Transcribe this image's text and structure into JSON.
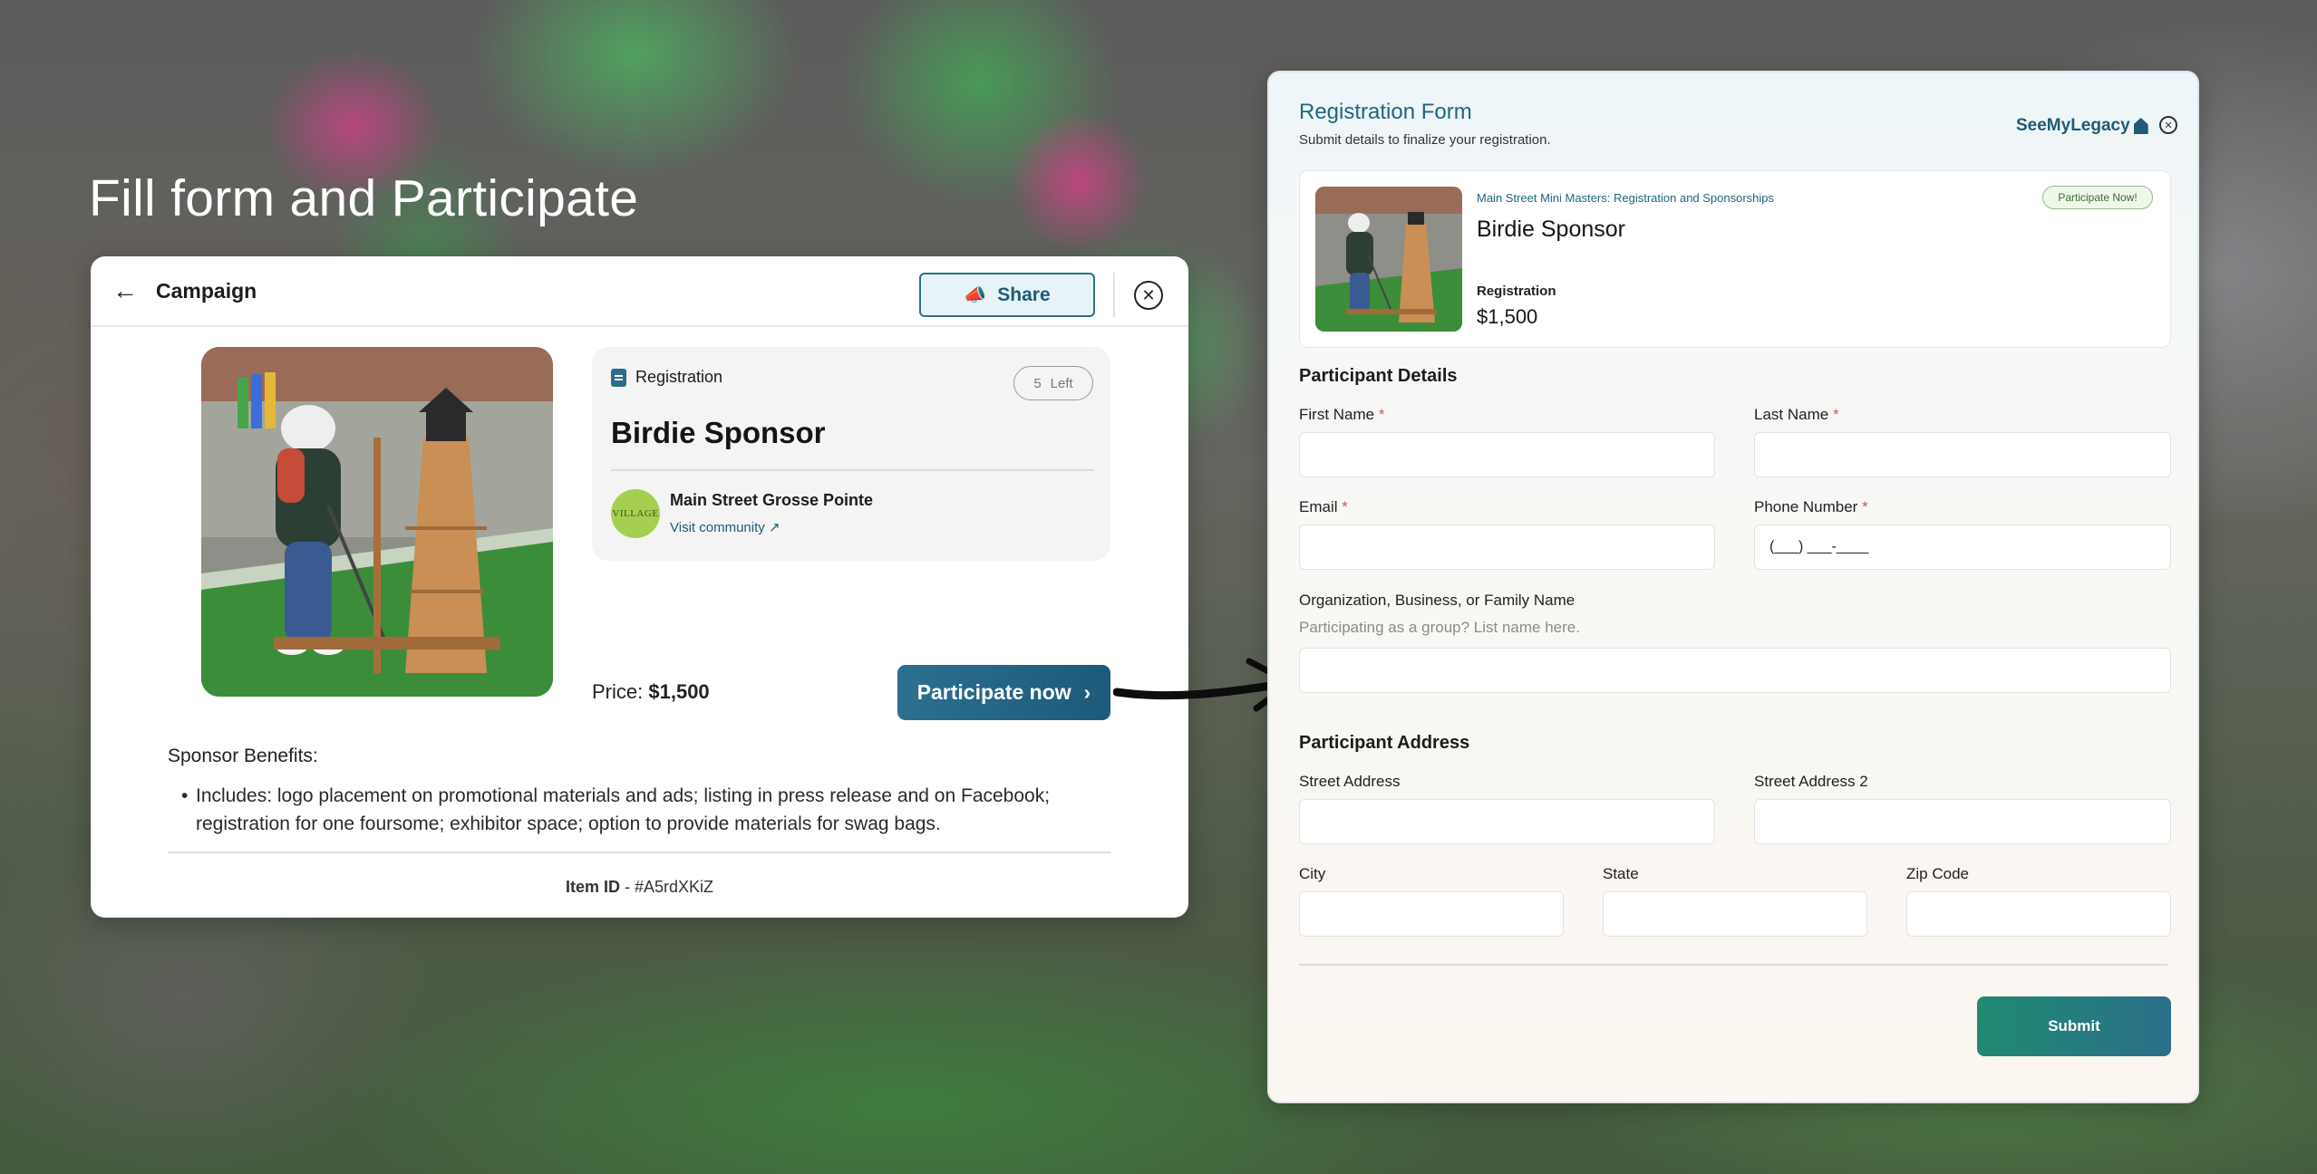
{
  "hero_title": "Fill form and Participate",
  "campaign": {
    "header_title": "Campaign",
    "share_label": "Share",
    "item_type": "Registration",
    "left_count": "5",
    "left_label": "Left",
    "item_title": "Birdie Sponsor",
    "community_logo_text": "VILLAGE",
    "community_name": "Main Street Grosse Pointe",
    "visit_label": "Visit community",
    "price_label": "Price:",
    "price_value": "$1,500",
    "participate_label": "Participate now",
    "benefits_title": "Sponsor Benefits:",
    "benefits_text": "Includes: logo placement on promotional materials and ads; listing in press release and on Facebook; registration for one foursome; exhibitor space; option to provide materials for swag bags.",
    "item_id_label": "Item ID",
    "item_id_value": "#A5rdXKiZ"
  },
  "form": {
    "title": "Registration Form",
    "subtitle": "Submit details to finalize your registration.",
    "brand": "SeeMyLegacy",
    "summary": {
      "campaign_name": "Main Street Mini Masters: Registration and Sponsorships",
      "badge": "Participate Now!",
      "item_title": "Birdie Sponsor",
      "type": "Registration",
      "price": "$1,500"
    },
    "participant_section": "Participant Details",
    "first_name_label": "First Name",
    "last_name_label": "Last Name",
    "email_label": "Email",
    "phone_label": "Phone Number",
    "phone_placeholder": "(___) ___-____",
    "org_label": "Organization, Business, or Family Name",
    "org_hint": "Participating as a group? List name here.",
    "address_section": "Participant Address",
    "street_label": "Street Address",
    "street2_label": "Street Address 2",
    "city_label": "City",
    "state_label": "State",
    "zip_label": "Zip Code",
    "required_mark": "*",
    "submit_label": "Submit"
  },
  "colors": {
    "brand_blue": "#1f5b78",
    "submit_gradient_start": "#1f8a70",
    "required_red": "#d9534f"
  }
}
